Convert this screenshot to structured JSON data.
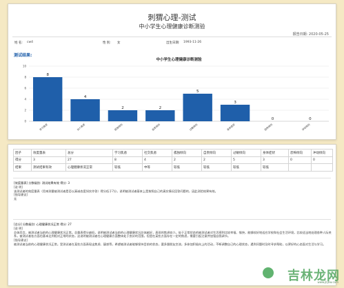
{
  "header": {
    "title": "刺猬心理-测试",
    "subtitle": "中小学生心理健康诊断测验",
    "report_date": "报告日期: 2020-05-25"
  },
  "info": {
    "name_label": "姓 名:",
    "name_value": "cw4",
    "gender_label": "性 别:",
    "gender_value": "女",
    "dob_label": "出生日期:",
    "dob_value": "1993-11-26"
  },
  "section": {
    "results_label": "测试结果:"
  },
  "colors": {
    "bar": "#1f5faa",
    "accent": "#1f5faa",
    "background": "#f5e9c4"
  },
  "chart_data": {
    "type": "bar",
    "title": "中小学生心理健康诊断测验",
    "categories": [
      "学习焦虑",
      "对人焦虑",
      "孤独倾向",
      "自责倾向",
      "过敏倾向",
      "身体症状",
      "恐怖倾向",
      "冲动倾向"
    ],
    "values": [
      8,
      4,
      2,
      2,
      5,
      3,
      0,
      0
    ],
    "ylim": [
      0,
      10
    ],
    "yticks": [
      0,
      2,
      4,
      6,
      8,
      10
    ],
    "grid": true
  },
  "table": {
    "rows": [
      [
        "因子",
        "效度量表",
        "总分",
        "学习焦虑",
        "社交焦虑",
        "孤独倾向",
        "自责倾向",
        "过敏倾向",
        "身体症状",
        "恐怖倾向",
        "冲动倾向"
      ],
      [
        "得分",
        "3",
        "27",
        "8",
        "4",
        "2",
        "2",
        "5",
        "3",
        "0",
        "0"
      ],
      [
        "结果",
        "测试结果有效",
        "心理健康状况正常",
        "较低",
        "中等",
        "较低",
        "较低",
        "较低",
        "较低",
        "",
        ""
      ]
    ]
  },
  "blocks": {
    "b1_head": "[效度量表] 分数级别: 测试结果有效 得分: 3",
    "b1_label": "[说 明]",
    "b1_body": "该测试者的效度量表（用来测量被测试者是否以真诚态度如实作答）得分低于7分，说明被测试者基本上是按照自己的真实情况回答问题的，因此测验结果有效。",
    "b1_advice_label": "[指导建议]",
    "b1_advice": "无",
    "b2_head": "[总分] 分数级别: 心理健康状况正常 得分: 27",
    "b2_label": "[说 明]",
    "b2_body": "总体而言，被测试者当前的心理健康状况正常。总量表得分越低，说明被测试者当前的心理健康状况总体越好，表现的焦虑较少。处于正常状态的被测试者对生活感到比较幸福、愉快，能够较好地适应学校和社会生活环境，比较适当地处理各种人际关系，被测试者各方面也基本达到相对正常的状态，这说明被测试者在心理健康方面整体处于良好的范围，但是在某些方面存在一定的焦虑，需要引起注意并加强自我调节。",
    "b2_advice_label": "[指导建议]",
    "b2_advice": "被测试者当前的心理健康状况正常。受测试者在某些方面表现出焦虑、疑惑等，希望被测试者能够保持目前的状态，要多跟朋友交流，多参加积极向上的活动，不断调整自己的心理状态，遇到问题时及时寻求帮助，以更好的心态面对生活与学习。"
  },
  "watermark": {
    "text": "吉林龙网",
    "url": "www.jlljtiw.com"
  }
}
